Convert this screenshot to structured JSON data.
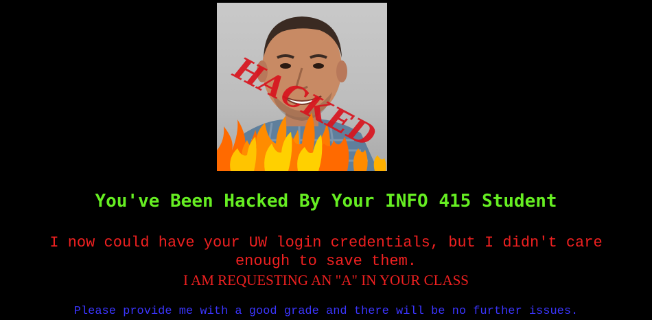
{
  "colors": {
    "background": "#000000",
    "headline": "#66ee22",
    "message": "#ee2020",
    "footer": "#3b35ff",
    "stamp": "#d8141e"
  },
  "image": {
    "stamp_text": "HACKED"
  },
  "headline": "You've Been Hacked By Your INFO 415 Student",
  "message": {
    "line1": "I now could have your UW login credentials, but I didn't care",
    "line2": "enough to save them."
  },
  "request": "I AM REQUESTING AN \"A\" IN YOUR CLASS",
  "footer_note": "Please provide me with a good grade and there will be no further issues."
}
